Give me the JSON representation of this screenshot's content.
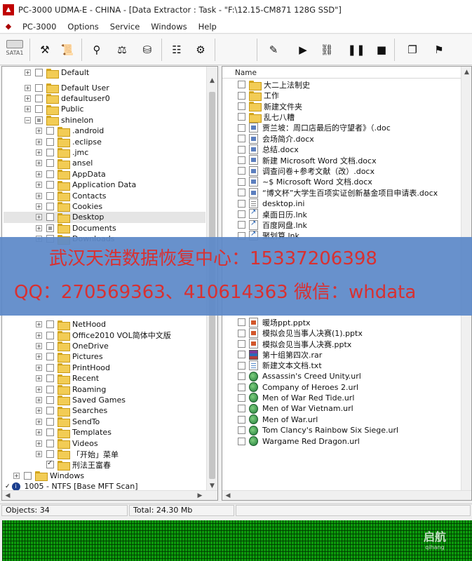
{
  "window": {
    "title": "PC-3000 UDMA-E - CHINA - [Data Extractor : Task - \"F:\\12.15-CM871 128G SSD\"]"
  },
  "menu": [
    "PC-3000",
    "Options",
    "Service",
    "Windows",
    "Help"
  ],
  "toolbar": {
    "sata_label": "SATA1"
  },
  "tree": [
    {
      "label": "Default",
      "indent": 0,
      "expander": "+",
      "check": "none",
      "cut": true
    },
    {
      "label": "Default User",
      "indent": 0,
      "expander": "+",
      "check": "none"
    },
    {
      "label": "defaultuser0",
      "indent": 0,
      "expander": "+",
      "check": "none"
    },
    {
      "label": "Public",
      "indent": 0,
      "expander": "+",
      "check": "none"
    },
    {
      "label": "shinelon",
      "indent": 0,
      "expander": "−",
      "check": "partial"
    },
    {
      "label": ".android",
      "indent": 1,
      "expander": "+",
      "check": "none"
    },
    {
      "label": ".eclipse",
      "indent": 1,
      "expander": "+",
      "check": "none"
    },
    {
      "label": ".jmc",
      "indent": 1,
      "expander": "+",
      "check": "none"
    },
    {
      "label": "ansel",
      "indent": 1,
      "expander": "+",
      "check": "none"
    },
    {
      "label": "AppData",
      "indent": 1,
      "expander": "+",
      "check": "none"
    },
    {
      "label": "Application Data",
      "indent": 1,
      "expander": "+",
      "check": "none"
    },
    {
      "label": "Contacts",
      "indent": 1,
      "expander": "+",
      "check": "none"
    },
    {
      "label": "Cookies",
      "indent": 1,
      "expander": "+",
      "check": "none"
    },
    {
      "label": "Desktop",
      "indent": 1,
      "expander": "+",
      "check": "none",
      "selected": true
    },
    {
      "label": "Documents",
      "indent": 1,
      "expander": "+",
      "check": "partial"
    },
    {
      "label": "Downloads",
      "indent": 1,
      "expander": "+",
      "check": "none"
    }
  ],
  "tree_lower": [
    {
      "label": "NetHood",
      "indent": 1,
      "expander": "+",
      "check": "none"
    },
    {
      "label": "Office2010 VOL简体中文版",
      "indent": 1,
      "expander": "+",
      "check": "none"
    },
    {
      "label": "OneDrive",
      "indent": 1,
      "expander": "+",
      "check": "none"
    },
    {
      "label": "Pictures",
      "indent": 1,
      "expander": "+",
      "check": "none"
    },
    {
      "label": "PrintHood",
      "indent": 1,
      "expander": "+",
      "check": "none"
    },
    {
      "label": "Recent",
      "indent": 1,
      "expander": "+",
      "check": "none"
    },
    {
      "label": "Roaming",
      "indent": 1,
      "expander": "+",
      "check": "none"
    },
    {
      "label": "Saved Games",
      "indent": 1,
      "expander": "+",
      "check": "none"
    },
    {
      "label": "Searches",
      "indent": 1,
      "expander": "+",
      "check": "none"
    },
    {
      "label": "SendTo",
      "indent": 1,
      "expander": "+",
      "check": "none"
    },
    {
      "label": "Templates",
      "indent": 1,
      "expander": "+",
      "check": "none"
    },
    {
      "label": "Videos",
      "indent": 1,
      "expander": "+",
      "check": "none"
    },
    {
      "label": "「开始」菜单",
      "indent": 1,
      "expander": "+",
      "check": "none"
    },
    {
      "label": "刑法王富春",
      "indent": 1,
      "expander": "",
      "check": "checked"
    },
    {
      "label": "Windows",
      "indent": -1,
      "expander": "+",
      "check": "none"
    }
  ],
  "partition": {
    "label": "1005 - NTFS [Base MFT Scan]"
  },
  "file_list": {
    "column_name": "Name",
    "items_upper": [
      {
        "name": "大二上法制史",
        "type": "folder"
      },
      {
        "name": "工作",
        "type": "folder"
      },
      {
        "name": "新建文件夹",
        "type": "folder"
      },
      {
        "name": "乱七八糟",
        "type": "folder"
      },
      {
        "name": "贾兰坡：周口店最后的守望者》（.doc",
        "type": "docx"
      },
      {
        "name": "会场简介.docx",
        "type": "docx"
      },
      {
        "name": "总结.docx",
        "type": "docx"
      },
      {
        "name": "新建 Microsoft Word 文档.docx",
        "type": "docx"
      },
      {
        "name": "调查问卷+参考文献（改）.docx",
        "type": "docx"
      },
      {
        "name": "~$ Microsoft Word 文档.docx",
        "type": "docx"
      },
      {
        "name": "“博文杯”大学生百项实证创新基金项目申请表.docx",
        "type": "docx"
      },
      {
        "name": "desktop.ini",
        "type": "ini"
      },
      {
        "name": "桌面日历.lnk",
        "type": "lnk"
      },
      {
        "name": "百度网盘.lnk",
        "type": "lnk"
      },
      {
        "name": "聚划算.lnk",
        "type": "lnk"
      }
    ],
    "items_lower": [
      {
        "name": "暖场ppt.pptx",
        "type": "pptx"
      },
      {
        "name": "模拟会见当事人决赛(1).pptx",
        "type": "pptx"
      },
      {
        "name": "模拟会见当事人决赛.pptx",
        "type": "pptx"
      },
      {
        "name": "第十组第四次.rar",
        "type": "rar"
      },
      {
        "name": "新建文本文档.txt",
        "type": "txt"
      },
      {
        "name": "Assassin's Creed Unity.url",
        "type": "url"
      },
      {
        "name": "Company of Heroes 2.url",
        "type": "url"
      },
      {
        "name": "Men of War Red Tide.url",
        "type": "url"
      },
      {
        "name": "Men of War Vietnam.url",
        "type": "url"
      },
      {
        "name": "Men of War.url",
        "type": "url"
      },
      {
        "name": "Tom Clancy's Rainbow Six Siege.url",
        "type": "url"
      },
      {
        "name": "Wargame Red Dragon.url",
        "type": "url"
      }
    ]
  },
  "watermark": {
    "line1": "武汉天浩数据恢复中心：15337206398",
    "line2": "QQ：270569363、410614363  微信：whdata"
  },
  "status": {
    "objects": "Objects: 34",
    "total": "Total: 24.30 Mb"
  },
  "logo": {
    "name": "启航",
    "sub": "qihang"
  }
}
